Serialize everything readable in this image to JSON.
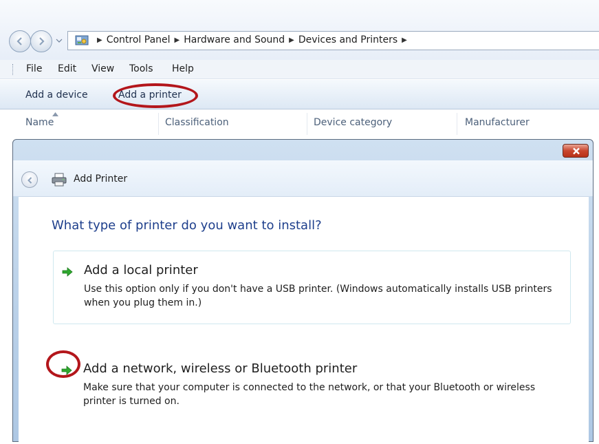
{
  "address_bar": {
    "breadcrumbs": [
      "Control Panel",
      "Hardware and Sound",
      "Devices and Printers"
    ]
  },
  "menu": {
    "items": [
      "File",
      "Edit",
      "View",
      "Tools",
      "Help"
    ]
  },
  "command_bar": {
    "add_device": "Add a device",
    "add_printer": "Add a printer"
  },
  "columns": [
    "Name",
    "Classification",
    "Device category",
    "Manufacturer"
  ],
  "dialog": {
    "title": "Add Printer",
    "question": "What type of printer do you want to install?",
    "options": [
      {
        "title": "Add a local printer",
        "description": "Use this option only if you don't have a USB printer. (Windows automatically installs USB printers when you plug them in.)"
      },
      {
        "title": "Add a network, wireless or Bluetooth printer",
        "description": "Make sure that your computer is connected to the network, or that your Bluetooth or wireless printer is turned on."
      }
    ]
  },
  "colors": {
    "highlight_ring": "#b3161b",
    "question_text": "#1e3f8c",
    "option_arrow": "#2fa82f"
  },
  "icons": [
    "back-arrow-icon",
    "forward-arrow-icon",
    "chevron-down-icon",
    "control-panel-icon",
    "breadcrumb-arrow-icon",
    "sort-up-icon",
    "close-icon",
    "printer-icon",
    "green-arrow-icon"
  ]
}
